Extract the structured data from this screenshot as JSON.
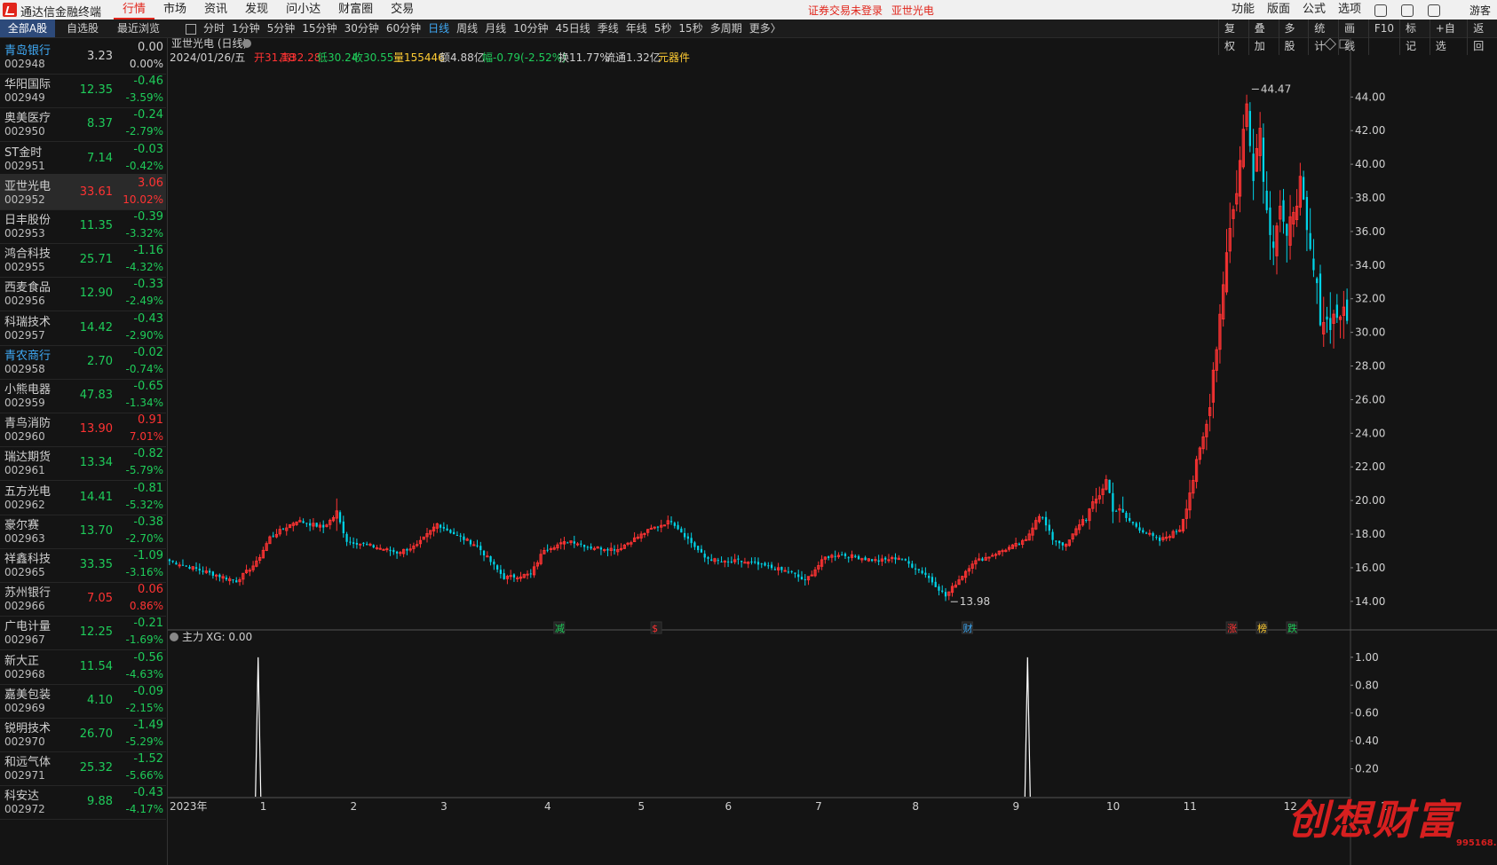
{
  "app": {
    "title": "通达信金融终端",
    "guest": "游客"
  },
  "menu": [
    "行情",
    "市场",
    "资讯",
    "发现",
    "问小达",
    "财富圈",
    "交易"
  ],
  "notice": {
    "text": "证券交易未登录",
    "stock": "亚世光电"
  },
  "right_menu": [
    "功能",
    "版面",
    "公式",
    "选项"
  ],
  "list_tabs": [
    "全部A股",
    "自选股",
    "最近浏览"
  ],
  "periods": [
    "分时",
    "1分钟",
    "5分钟",
    "15分钟",
    "30分钟",
    "60分钟",
    "日线",
    "周线",
    "月线",
    "10分钟",
    "45日线",
    "季线",
    "年线",
    "5秒",
    "15秒",
    "多周期",
    "更多〉"
  ],
  "active_period": "日线",
  "tools": [
    "复权",
    "叠加",
    "多股",
    "统计",
    "画线",
    "F10",
    "标记",
    "+自选",
    "返回"
  ],
  "stocks": [
    {
      "name": "青岛银行",
      "code": "002948",
      "price": "3.23",
      "chg": "0.00",
      "pct": "0.00%",
      "dir": "fl",
      "blue": true
    },
    {
      "name": "华阳国际",
      "code": "002949",
      "price": "12.35",
      "chg": "-0.46",
      "pct": "-3.59%",
      "dir": "dn"
    },
    {
      "name": "奥美医疗",
      "code": "002950",
      "price": "8.37",
      "chg": "-0.24",
      "pct": "-2.79%",
      "dir": "dn"
    },
    {
      "name": "ST金时",
      "code": "002951",
      "price": "7.14",
      "chg": "-0.03",
      "pct": "-0.42%",
      "dir": "dn"
    },
    {
      "name": "亚世光电",
      "code": "002952",
      "price": "33.61",
      "chg": "3.06",
      "pct": "10.02%",
      "dir": "up",
      "selected": true
    },
    {
      "name": "日丰股份",
      "code": "002953",
      "price": "11.35",
      "chg": "-0.39",
      "pct": "-3.32%",
      "dir": "dn"
    },
    {
      "name": "鸿合科技",
      "code": "002955",
      "price": "25.71",
      "chg": "-1.16",
      "pct": "-4.32%",
      "dir": "dn"
    },
    {
      "name": "西麦食品",
      "code": "002956",
      "price": "12.90",
      "chg": "-0.33",
      "pct": "-2.49%",
      "dir": "dn"
    },
    {
      "name": "科瑞技术",
      "code": "002957",
      "price": "14.42",
      "chg": "-0.43",
      "pct": "-2.90%",
      "dir": "dn"
    },
    {
      "name": "青农商行",
      "code": "002958",
      "price": "2.70",
      "chg": "-0.02",
      "pct": "-0.74%",
      "dir": "dn",
      "blue": true
    },
    {
      "name": "小熊电器",
      "code": "002959",
      "price": "47.83",
      "chg": "-0.65",
      "pct": "-1.34%",
      "dir": "dn"
    },
    {
      "name": "青鸟消防",
      "code": "002960",
      "price": "13.90",
      "chg": "0.91",
      "pct": "7.01%",
      "dir": "up"
    },
    {
      "name": "瑞达期货",
      "code": "002961",
      "price": "13.34",
      "chg": "-0.82",
      "pct": "-5.79%",
      "dir": "dn"
    },
    {
      "name": "五方光电",
      "code": "002962",
      "price": "14.41",
      "chg": "-0.81",
      "pct": "-5.32%",
      "dir": "dn"
    },
    {
      "name": "豪尔赛",
      "code": "002963",
      "price": "13.70",
      "chg": "-0.38",
      "pct": "-2.70%",
      "dir": "dn"
    },
    {
      "name": "祥鑫科技",
      "code": "002965",
      "price": "33.35",
      "chg": "-1.09",
      "pct": "-3.16%",
      "dir": "dn"
    },
    {
      "name": "苏州银行",
      "code": "002966",
      "price": "7.05",
      "chg": "0.06",
      "pct": "0.86%",
      "dir": "up"
    },
    {
      "name": "广电计量",
      "code": "002967",
      "price": "12.25",
      "chg": "-0.21",
      "pct": "-1.69%",
      "dir": "dn"
    },
    {
      "name": "新大正",
      "code": "002968",
      "price": "11.54",
      "chg": "-0.56",
      "pct": "-4.63%",
      "dir": "dn"
    },
    {
      "name": "嘉美包装",
      "code": "002969",
      "price": "4.10",
      "chg": "-0.09",
      "pct": "-2.15%",
      "dir": "dn"
    },
    {
      "name": "锐明技术",
      "code": "002970",
      "price": "26.70",
      "chg": "-1.49",
      "pct": "-5.29%",
      "dir": "dn"
    },
    {
      "name": "和远气体",
      "code": "002971",
      "price": "25.32",
      "chg": "-1.52",
      "pct": "-5.66%",
      "dir": "dn"
    },
    {
      "name": "科安达",
      "code": "002972",
      "price": "9.88",
      "chg": "-0.43",
      "pct": "-4.17%",
      "dir": "dn"
    }
  ],
  "chart_header": {
    "name": "亚世光电 (日线)",
    "date": "2024/01/26/五",
    "open": "开31.18",
    "high": "高32.28",
    "low": "低30.24",
    "close": "收30.55",
    "vol": "量155446",
    "amount": "额4.88亿",
    "range": "幅-0.79(-2.52%)",
    "turnover": "换11.77%",
    "float": "流通1.32亿",
    "extra": "元器件"
  },
  "sub_header": {
    "label": "主力",
    "value": "XG: 0.00"
  },
  "chart_data": {
    "type": "candlestick",
    "y_ticks": [
      "44.00",
      "42.00",
      "40.00",
      "38.00",
      "36.00",
      "34.00",
      "32.00",
      "30.00",
      "28.00",
      "26.00",
      "24.00",
      "22.00",
      "20.00",
      "18.00",
      "16.00",
      "14.00"
    ],
    "ylim": [
      13.2,
      45.6
    ],
    "high_label": "44.47",
    "low_label": "13.98",
    "x_labels": [
      "2023年",
      "1",
      "2",
      "3",
      "4",
      "5",
      "6",
      "7",
      "8",
      "9",
      "10",
      "11",
      "12",
      "1"
    ],
    "markers": [
      {
        "text": "减",
        "color": "#1fcc5a"
      },
      {
        "text": "$",
        "color": "#ff3333"
      },
      {
        "text": "财",
        "color": "#3fa9f5"
      },
      {
        "text": "涨",
        "color": "#ff3333"
      },
      {
        "text": "榜",
        "color": "#ffcc33"
      },
      {
        "text": "跌",
        "color": "#1fcc5a"
      }
    ],
    "sub_y_ticks": [
      "1.00",
      "0.80",
      "0.60",
      "0.40",
      "0.20"
    ],
    "sub_ylim": [
      0,
      1.05
    ],
    "sub_spikes": [
      {
        "index": 27,
        "value": 1.0
      },
      {
        "index": 257,
        "value": 1.0
      }
    ],
    "keypoints": [
      [
        0,
        16.4
      ],
      [
        10,
        15.8
      ],
      [
        20,
        15.2
      ],
      [
        26,
        16.3
      ],
      [
        30,
        17.8
      ],
      [
        38,
        18.8
      ],
      [
        46,
        18.4
      ],
      [
        50,
        19.2
      ],
      [
        53,
        17.6
      ],
      [
        60,
        17.3
      ],
      [
        68,
        16.9
      ],
      [
        74,
        17.3
      ],
      [
        80,
        18.6
      ],
      [
        86,
        17.9
      ],
      [
        92,
        17.3
      ],
      [
        100,
        15.4
      ],
      [
        108,
        15.6
      ],
      [
        112,
        17.1
      ],
      [
        120,
        17.6
      ],
      [
        126,
        17.2
      ],
      [
        134,
        17.1
      ],
      [
        138,
        17.6
      ],
      [
        144,
        18.3
      ],
      [
        150,
        18.8
      ],
      [
        160,
        16.6
      ],
      [
        166,
        16.3
      ],
      [
        170,
        16.4
      ],
      [
        178,
        16.1
      ],
      [
        186,
        15.7
      ],
      [
        190,
        15.2
      ],
      [
        196,
        16.6
      ],
      [
        200,
        16.8
      ],
      [
        206,
        16.6
      ],
      [
        212,
        16.4
      ],
      [
        218,
        16.6
      ],
      [
        226,
        15.6
      ],
      [
        232,
        14.3
      ],
      [
        236,
        15.3
      ],
      [
        240,
        16.3
      ],
      [
        244,
        16.6
      ],
      [
        250,
        17.1
      ],
      [
        256,
        17.6
      ],
      [
        260,
        19.3
      ],
      [
        264,
        17.7
      ],
      [
        268,
        17.3
      ],
      [
        272,
        18.6
      ],
      [
        276,
        19.6
      ],
      [
        280,
        21.2
      ],
      [
        282,
        19.6
      ],
      [
        290,
        18.3
      ],
      [
        296,
        17.6
      ],
      [
        302,
        18.3
      ],
      [
        306,
        21.3
      ],
      [
        310,
        24.5
      ],
      [
        312,
        27.8
      ],
      [
        314,
        31.1
      ],
      [
        316,
        35.1
      ],
      [
        318,
        37.2
      ],
      [
        320,
        40.1
      ],
      [
        322,
        43.6
      ],
      [
        324,
        39.7
      ],
      [
        326,
        42.2
      ],
      [
        328,
        37.1
      ],
      [
        330,
        35.6
      ],
      [
        332,
        37.6
      ],
      [
        334,
        35.1
      ],
      [
        336,
        37.6
      ],
      [
        338,
        38.8
      ],
      [
        340,
        35.6
      ],
      [
        342,
        33.6
      ],
      [
        344,
        31.1
      ],
      [
        346,
        30.6
      ],
      [
        350,
        31.2
      ],
      [
        352,
        30.55
      ]
    ]
  }
}
